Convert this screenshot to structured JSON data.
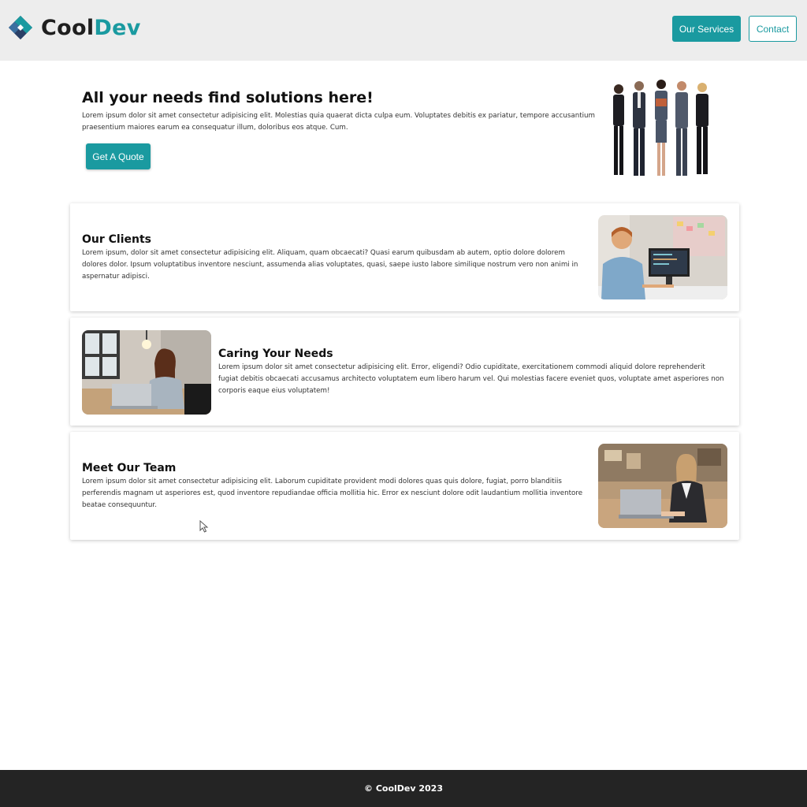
{
  "brand": {
    "name_part1": "Cool",
    "name_part2": "Dev",
    "accent_color": "#1a9aa0"
  },
  "nav": {
    "services_label": "Our Services",
    "contact_label": "Contact"
  },
  "hero": {
    "title": "All your needs find solutions here!",
    "text": "Lorem ipsum dolor sit amet consectetur adipisicing elit. Molestias quia quaerat dicta culpa eum. Voluptates debitis ex pariatur, tempore accusantium praesentium maiores earum ea consequatur illum, doloribus eos atque. Cum.",
    "cta_label": "Get A Quote"
  },
  "cards": [
    {
      "title": "Our Clients",
      "text": "Lorem ipsum, dolor sit amet consectetur adipisicing elit. Aliquam, quam obcaecati? Quasi earum quibusdam ab autem, optio dolore dolorem dolores dolor. Ipsum voluptatibus inventore nesciunt, assumenda alias voluptates, quasi, saepe iusto labore similique nostrum vero non animi in aspernatur adipisci."
    },
    {
      "title": "Caring Your Needs",
      "text": "Lorem ipsum dolor sit amet consectetur adipisicing elit. Error, eligendi? Odio cupiditate, exercitationem commodi aliquid dolore reprehenderit fugiat debitis obcaecati accusamus architecto voluptatem eum libero harum vel. Qui molestias facere eveniet quos, voluptate amet asperiores non corporis eaque eius voluptatem!"
    },
    {
      "title": "Meet Our Team",
      "text": "Lorem ipsum dolor sit amet consectetur adipisicing elit. Laborum cupiditate provident modi dolores quas quis dolore, fugiat, porro blanditiis perferendis magnam ut asperiores est, quod inventore repudiandae officia mollitia hic. Error ex nesciunt dolore odit laudantium mollitia inventore beatae consequuntur."
    }
  ],
  "footer": {
    "copyright": "© CoolDev 2023"
  }
}
